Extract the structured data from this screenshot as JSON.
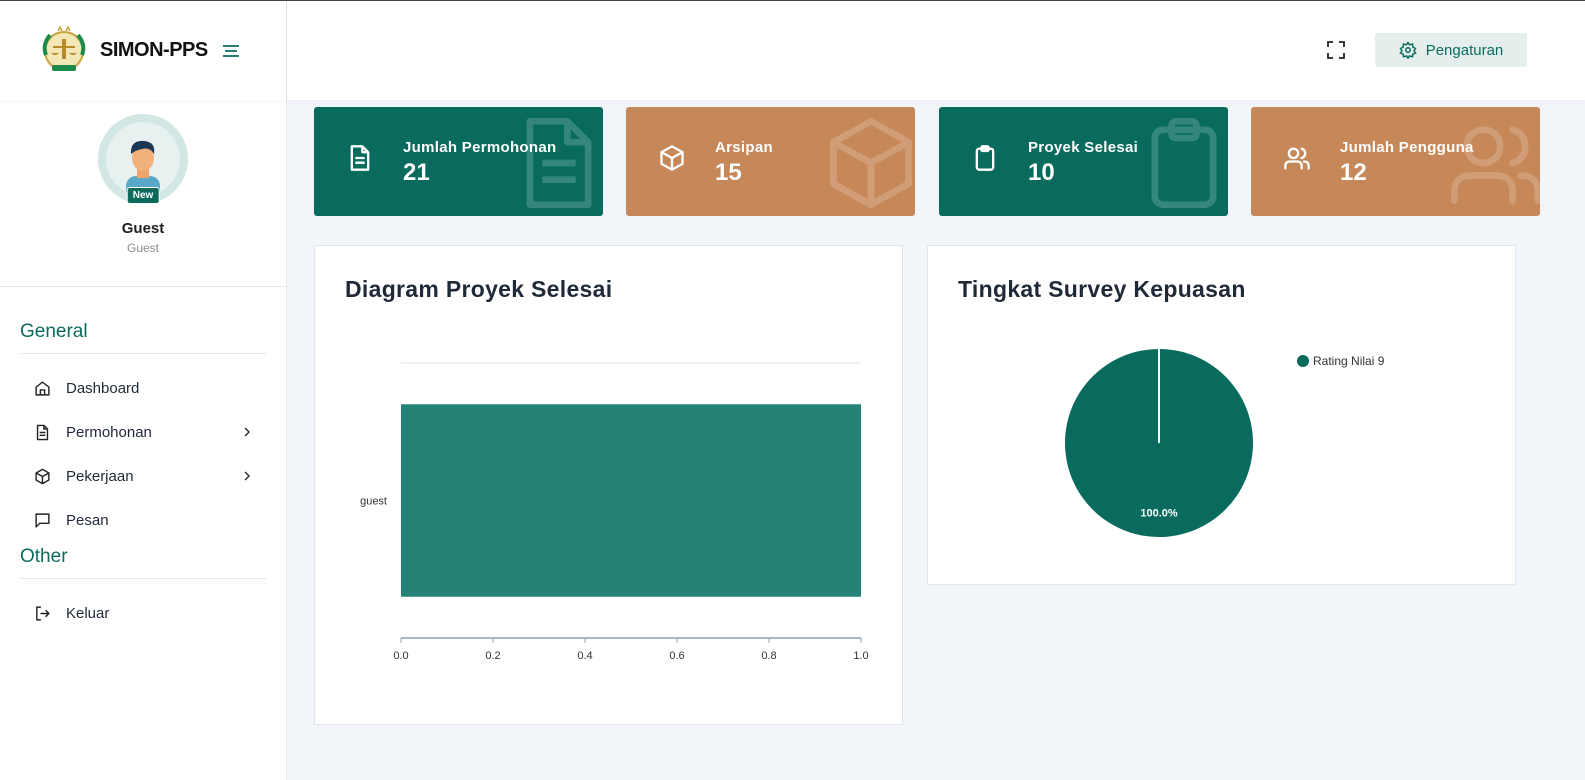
{
  "app": {
    "title": "SIMON-PPS"
  },
  "user": {
    "name": "Guest",
    "role": "Guest",
    "badge": "New"
  },
  "menu": {
    "general_heading": "General",
    "other_heading": "Other",
    "items": [
      {
        "label": "Dashboard",
        "icon": "home-icon"
      },
      {
        "label": "Permohonan",
        "icon": "document-icon"
      },
      {
        "label": "Pekerjaan",
        "icon": "box-icon"
      },
      {
        "label": "Pesan",
        "icon": "message-icon"
      }
    ],
    "other_items": [
      {
        "label": "Keluar",
        "icon": "logout-icon"
      }
    ]
  },
  "topbar": {
    "settings_label": "Pengaturan"
  },
  "stats": [
    {
      "title": "Jumlah Permohonan",
      "value": "21",
      "color": "#086b5e",
      "icon": "document-icon"
    },
    {
      "title": "Arsipan",
      "value": "15",
      "color": "#c68859",
      "icon": "box-icon"
    },
    {
      "title": "Proyek Selesai",
      "value": "10",
      "color": "#086b5e",
      "icon": "clipboard-icon"
    },
    {
      "title": "Jumlah Pengguna",
      "value": "12",
      "color": "#c68859",
      "icon": "users-icon"
    }
  ],
  "panels": {
    "bar_title": "Diagram Proyek Selesai",
    "pie_title": "Tingkat Survey Kepuasan"
  },
  "chart_data": [
    {
      "type": "bar",
      "orientation": "horizontal",
      "title": "Diagram Proyek Selesai",
      "categories": [
        "guest"
      ],
      "values": [
        1.0
      ],
      "xlim": [
        0,
        1.0
      ],
      "xticks": [
        "0.0",
        "0.2",
        "0.4",
        "0.6",
        "0.8",
        "1.0"
      ],
      "color": "#258276"
    },
    {
      "type": "pie",
      "title": "Tingkat Survey Kepuasan",
      "labels": [
        "Rating Nilai 9"
      ],
      "values": [
        100.0
      ],
      "value_labels": [
        "100.0%"
      ],
      "colors": [
        "#086b5e"
      ],
      "legend_position": "top-right"
    }
  ]
}
